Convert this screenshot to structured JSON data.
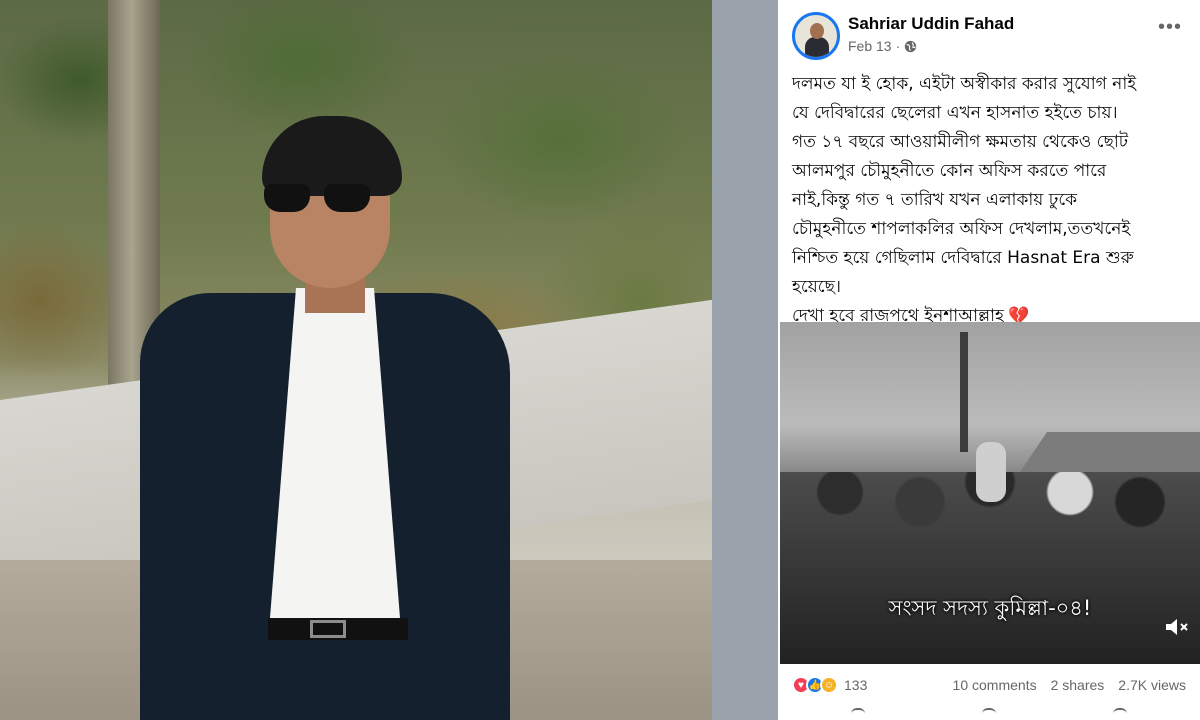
{
  "post": {
    "author": "Sahriar Uddin Fahad",
    "date": "Feb 13",
    "separator": "·",
    "more_icon": "more-horizontal-icon",
    "privacy_icon": "globe-icon",
    "text_lines": [
      "দলমত যা ই হোক, এইটা অস্বীকার করার সুযোগ নাই",
      "যে দেবিদ্বারের ছেলেরা এখন হাসনাত হইতে চায়।",
      "গত ১৭ বছরে আওয়ামীলীগ ক্ষমতায় থেকেও ছোট",
      "আলমপুর চৌমুহনীতে কোন অফিস করতে পারে",
      "নাই,কিন্তু গত ৭ তারিখ যখন এলাকায় ঢুকে",
      "চৌমুহনীতে শাপলাকলির অফিস দেখলাম,ততখনেই",
      "নিশ্চিত হয়ে গেছিলাম দেবিদ্বারে Hasnat Era শুরু",
      "হয়েছে।",
      "দেখা হবে রাজপথে ইনশাআল্লাহ"
    ],
    "heart_emoji": "💔",
    "video": {
      "caption": "সংসদ সদস্য কুমিল্লা-০৪!",
      "mute_icon": "volume-muted-icon"
    },
    "stats": {
      "reaction_count": "133",
      "comments": "10 comments",
      "shares": "2 shares",
      "views": "2.7K views"
    }
  },
  "colors": {
    "accent": "#1877f2",
    "meta_text": "#65676b",
    "love": "#f33e58",
    "care": "#f7b125"
  }
}
